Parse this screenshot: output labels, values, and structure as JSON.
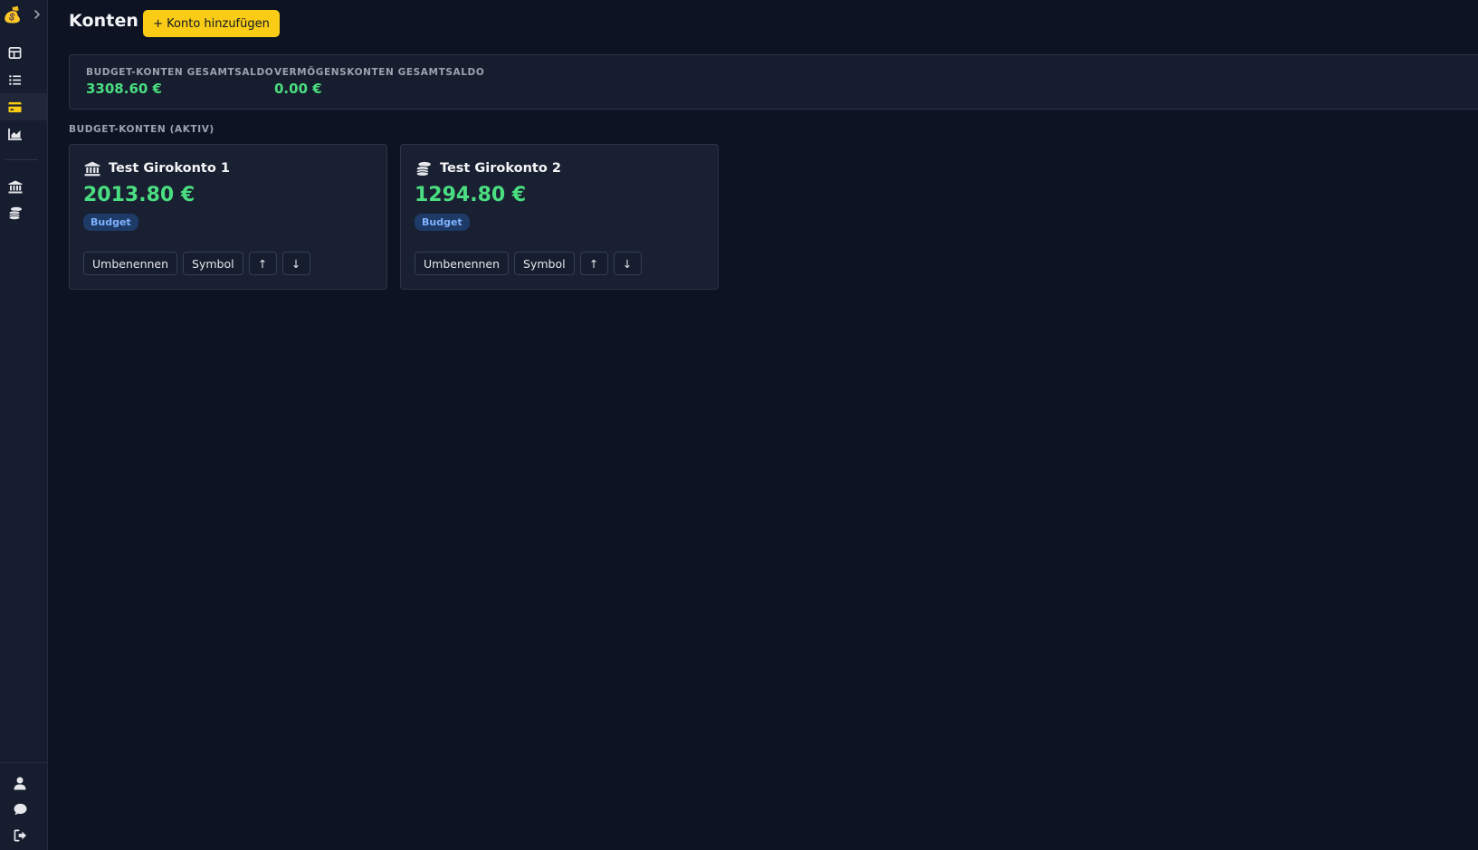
{
  "app": {
    "logo_glyph": "💰"
  },
  "sidebar": {
    "nav_icons": [
      "dashboard-icon",
      "list-icon",
      "credit-card-icon",
      "chart-icon",
      "bank-icon",
      "coins-icon"
    ],
    "active_item": "credit-card-icon",
    "bottom_icons": [
      "user-icon",
      "chat-icon",
      "logout-icon"
    ]
  },
  "header": {
    "title": "Konten",
    "add_button_label": "+ Konto hinzufügen"
  },
  "summary": {
    "budget_label": "BUDGET-KONTEN GESAMTSALDO",
    "budget_value": "3308.60 €",
    "assets_label": "VERMÖGENSKONTEN GESAMTSALDO",
    "assets_value": "0.00 €"
  },
  "section": {
    "label": "BUDGET-KONTEN (AKTIV)"
  },
  "accounts": [
    {
      "name": "Test Girokonto 1",
      "icon": "bank-icon",
      "balance": "2013.80 €",
      "badge": "Budget",
      "rename_label": "Umbenennen",
      "symbol_label": "Symbol",
      "up_glyph": "↑",
      "down_glyph": "↓"
    },
    {
      "name": "Test Girokonto 2",
      "icon": "coins-icon",
      "balance": "1294.80 €",
      "badge": "Budget",
      "rename_label": "Umbenennen",
      "symbol_label": "Symbol",
      "up_glyph": "↑",
      "down_glyph": "↓"
    }
  ],
  "colors": {
    "background": "#0d1322",
    "sidebar": "#161d2e",
    "accent": "#facc15",
    "positive": "#4ade80",
    "badge_bg": "#1e3a66",
    "badge_text": "#7fb2ff"
  }
}
